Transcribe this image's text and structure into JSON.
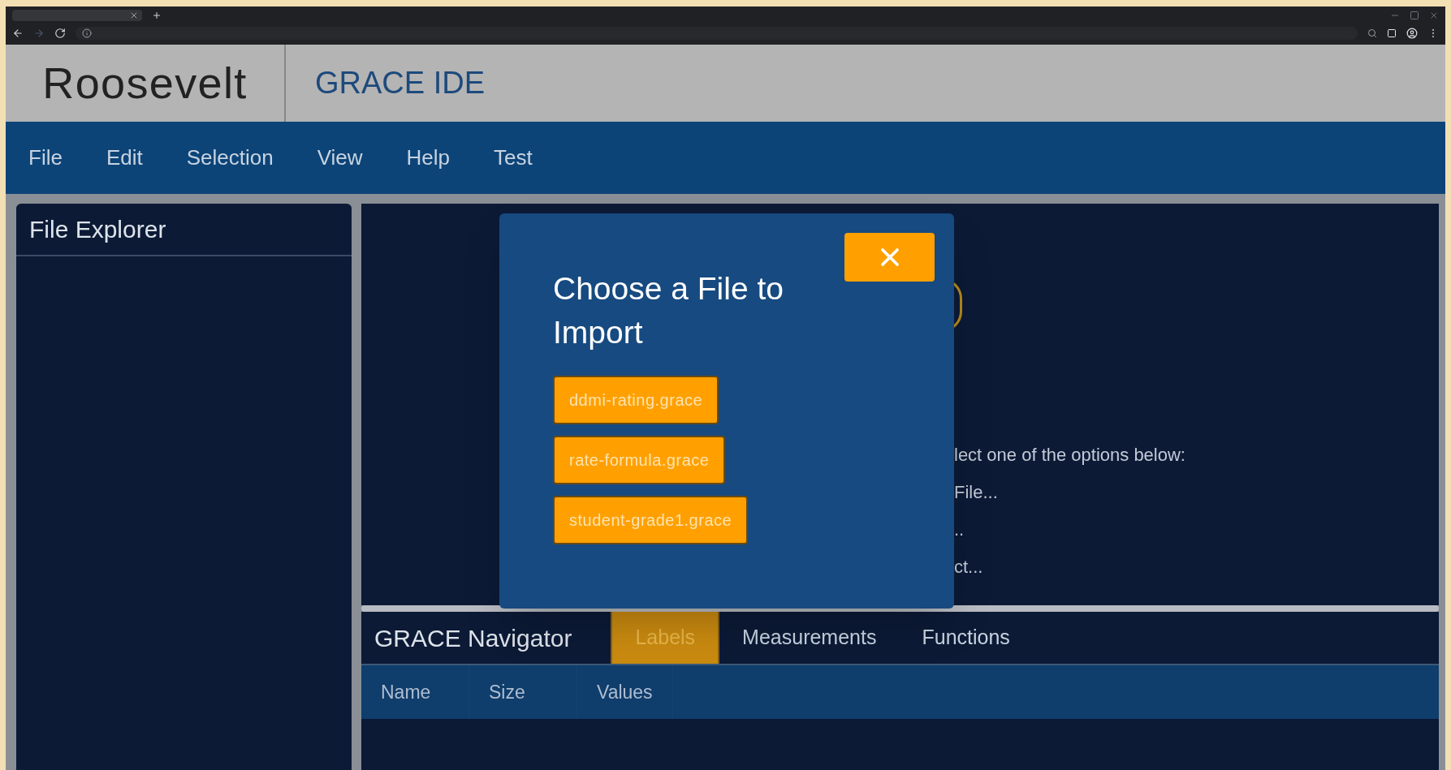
{
  "header": {
    "logo": "Roosevelt",
    "title": "GRACE IDE"
  },
  "menu": [
    "File",
    "Edit",
    "Selection",
    "View",
    "Help",
    "Test"
  ],
  "file_explorer": {
    "title": "File Explorer"
  },
  "editor": {
    "lines": [
      "lect one of the options below:",
      "File...",
      "..",
      "ct..."
    ]
  },
  "dialog": {
    "title": "Choose a File to Import",
    "files": [
      "ddmi-rating.grace",
      "rate-formula.grace",
      "student-grade1.grace"
    ]
  },
  "navigator": {
    "title": "GRACE Navigator",
    "tabs": [
      {
        "label": "Labels",
        "selected": true
      },
      {
        "label": "Measurements",
        "selected": false
      },
      {
        "label": "Functions",
        "selected": false
      }
    ],
    "table": {
      "columns": [
        "Name",
        "Size",
        "Values"
      ]
    }
  }
}
